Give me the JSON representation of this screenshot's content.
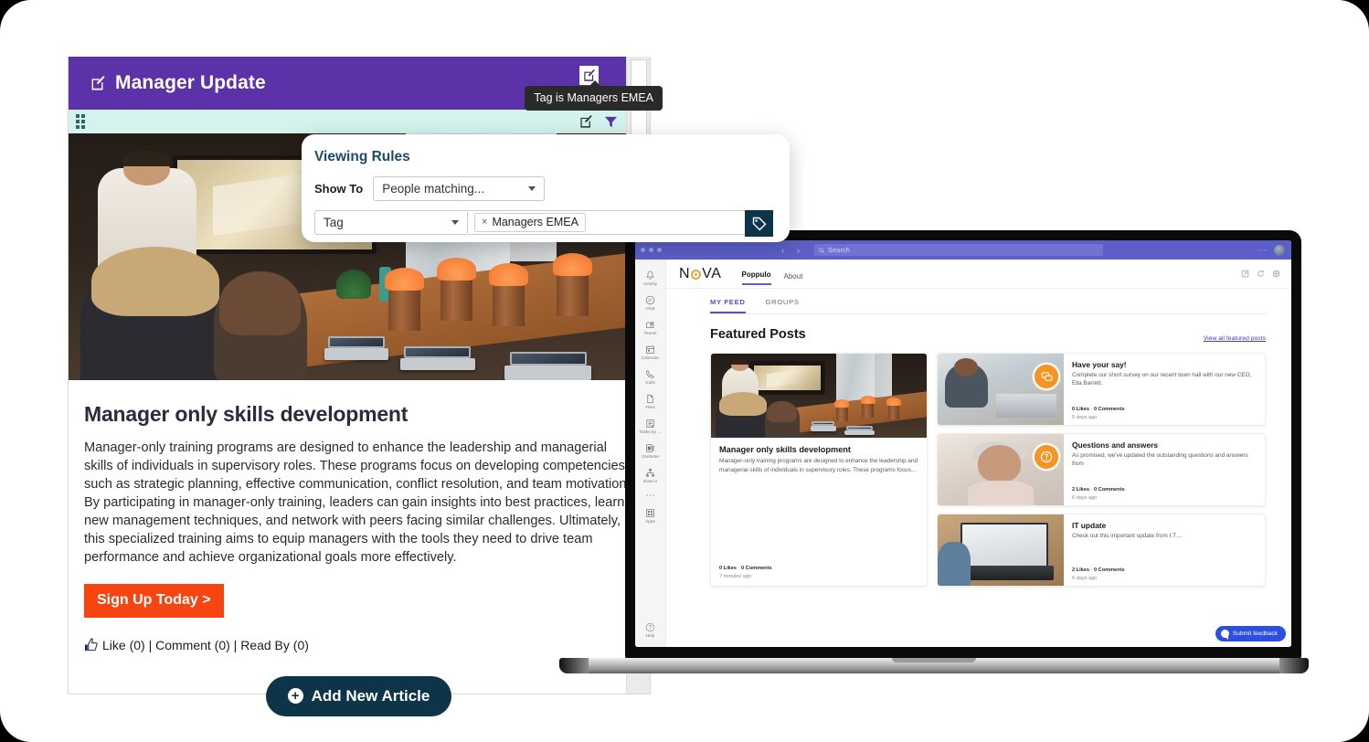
{
  "left_panel": {
    "header_title": "Manager Update",
    "tooltip": "Tag is Managers EMEA",
    "viewing_rules": {
      "title": "Viewing Rules",
      "show_to_label": "Show To",
      "show_to_value": "People matching...",
      "criteria_value": "Tag",
      "chip_label": "Managers EMEA",
      "chip_remove": "×"
    },
    "article": {
      "title": "Manager only skills development",
      "body": "Manager-only training programs are designed to enhance the leadership and managerial skills of individuals in supervisory roles. These programs focus on developing competencies such as strategic planning, effective communication, conflict resolution, and team motivation. By participating in manager-only training, leaders can gain insights into best practices, learn new management techniques, and network with peers facing similar challenges. Ultimately, this specialized training aims to equip managers with the tools they need to drive team performance and achieve organizational goals more effectively.",
      "cta_label": "Sign Up Today >",
      "meta": "Like (0) | Comment (0) | Read By (0)"
    },
    "add_article_label": "Add New Article",
    "add_article_plus": "+",
    "colors": {
      "header_purple": "#5b32a8",
      "toolbar_mint": "#d5f3ee",
      "cta_orange": "#f74511",
      "navy": "#0d3449"
    }
  },
  "teams": {
    "search_placeholder": "Search",
    "nav_back": "‹",
    "nav_forward": "›",
    "overflow": "···",
    "rail_items": [
      {
        "label": "Activity",
        "icon": "bell-icon"
      },
      {
        "label": "Chat",
        "icon": "chat-icon"
      },
      {
        "label": "Teams",
        "icon": "teams-icon"
      },
      {
        "label": "Calendar",
        "icon": "calendar-icon"
      },
      {
        "label": "Calls",
        "icon": "phone-icon"
      },
      {
        "label": "Files",
        "icon": "file-icon"
      },
      {
        "label": "Tasks by ...",
        "icon": "tasks-icon"
      },
      {
        "label": "OneNote",
        "icon": "onenote-icon"
      },
      {
        "label": "draw.io",
        "icon": "drawio-icon"
      },
      {
        "label": "",
        "icon": "more-icon"
      },
      {
        "label": "Apps",
        "icon": "apps-icon"
      }
    ],
    "help_item": {
      "label": "Help",
      "icon": "help-icon"
    }
  },
  "nova": {
    "logo_n": "N",
    "logo_va": "VA",
    "tabs": [
      {
        "label": "Poppulo",
        "active": true
      },
      {
        "label": "About",
        "active": false
      }
    ],
    "sub_tabs": [
      {
        "label": "MY FEED",
        "active": true
      },
      {
        "label": "GROUPS",
        "active": false
      }
    ],
    "featured_title": "Featured Posts",
    "featured_link": "View all featured posts",
    "feature_card": {
      "title": "Manager only skills development",
      "excerpt": "Manager-only training programs are designed to enhance the leadership and managerial skills of individuals in supervisory roles. These programs focus…",
      "likes": "0 Likes",
      "sep": "·",
      "comments": "0 Comments",
      "time": "7 minutes ago"
    },
    "side_cards": [
      {
        "title": "Have your say!",
        "excerpt": "Complete our short survey on our recent town hall with our new CEO, Ella Barrett.",
        "likes": "0 Likes",
        "sep": "·",
        "comments": "0 Comments",
        "time": "5 days ago",
        "badge_icon": "speech-bubbles-icon",
        "badge_glyph": "💬"
      },
      {
        "title": "Questions and answers",
        "excerpt": "As promised, we've updated the outstanding questions and answers from",
        "likes": "2 Likes",
        "sep": "·",
        "comments": "0 Comments",
        "time": "6 days ago",
        "badge_icon": "question-mark-icon",
        "badge_glyph": "?"
      },
      {
        "title": "IT update",
        "excerpt": "Check out this important update from I.T…",
        "likes": "2 Likes",
        "sep": "·",
        "comments": "0 Comments",
        "time": "6 days ago",
        "badge_icon": "none",
        "badge_glyph": ""
      }
    ],
    "feedback_label": "Submit feedback",
    "accent": "#5b4ad6"
  }
}
